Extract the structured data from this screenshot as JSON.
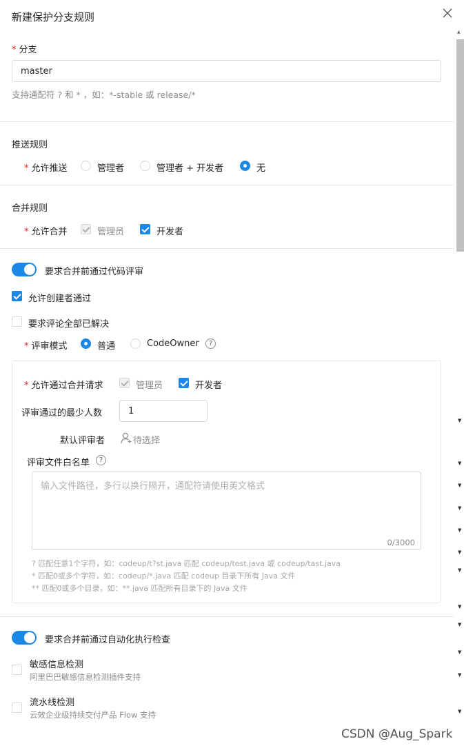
{
  "dialog": {
    "title": "新建保护分支规则"
  },
  "branch": {
    "label": "分支",
    "value": "master",
    "help": "支持通配符 ? 和 * ，如：*-stable 或 release/*"
  },
  "push": {
    "section": "推送规则",
    "field_label": "允许推送",
    "options": [
      {
        "label": "管理者",
        "selected": false
      },
      {
        "label": "管理者 + 开发者",
        "selected": false
      },
      {
        "label": "无",
        "selected": true
      }
    ]
  },
  "merge": {
    "section": "合并规则",
    "field_label": "允许合并",
    "options": [
      {
        "label": "管理员",
        "checked": true,
        "disabled": true
      },
      {
        "label": "开发者",
        "checked": true,
        "disabled": false
      }
    ]
  },
  "review": {
    "toggle_label": "要求合并前通过代码评审",
    "toggle_on": true,
    "allow_creator": {
      "label": "允许创建者通过",
      "checked": true
    },
    "resolve_all": {
      "label": "要求评论全部已解决",
      "checked": false
    },
    "mode": {
      "label": "评审模式",
      "options": [
        {
          "label": "普通",
          "selected": true
        },
        {
          "label": "CodeOwner",
          "selected": false
        }
      ]
    },
    "allow_merge": {
      "label": "允许通过合并请求",
      "options": [
        {
          "label": "管理员",
          "checked": true,
          "disabled": true
        },
        {
          "label": "开发者",
          "checked": true,
          "disabled": false
        }
      ]
    },
    "min_count": {
      "label": "评审通过的最少人数",
      "value": "1"
    },
    "default_reviewer": {
      "label": "默认评审者",
      "action": "待选择"
    },
    "whitelist": {
      "label": "评审文件白名单",
      "placeholder": "输入文件路径，多行以换行隔开，通配符请使用英文格式",
      "counter": "0/3000",
      "hints": [
        "? 匹配任意1个字符，如：codeup/t?st.java 匹配 codeup/test.java 或 codeup/tast.java",
        "* 匹配0或多个字符，如：codeup/*.java 匹配 codeup 目录下所有 Java 文件",
        "** 匹配0或多个目录，如：**.java 匹配所有目录下的 Java 文件"
      ]
    }
  },
  "auto_check": {
    "toggle_label": "要求合并前通过自动化执行检查",
    "toggle_on": true,
    "items": [
      {
        "title": "敏感信息检测",
        "desc": "阿里巴巴敏感信息检测插件支持",
        "checked": false
      },
      {
        "title": "流水线检测",
        "desc": "云效企业级持续交付产品 Flow 支持",
        "checked": false
      }
    ]
  },
  "watermark": "CSDN @Aug_Spark",
  "colors": {
    "accent": "#1b87e6",
    "required": "#e62412"
  }
}
